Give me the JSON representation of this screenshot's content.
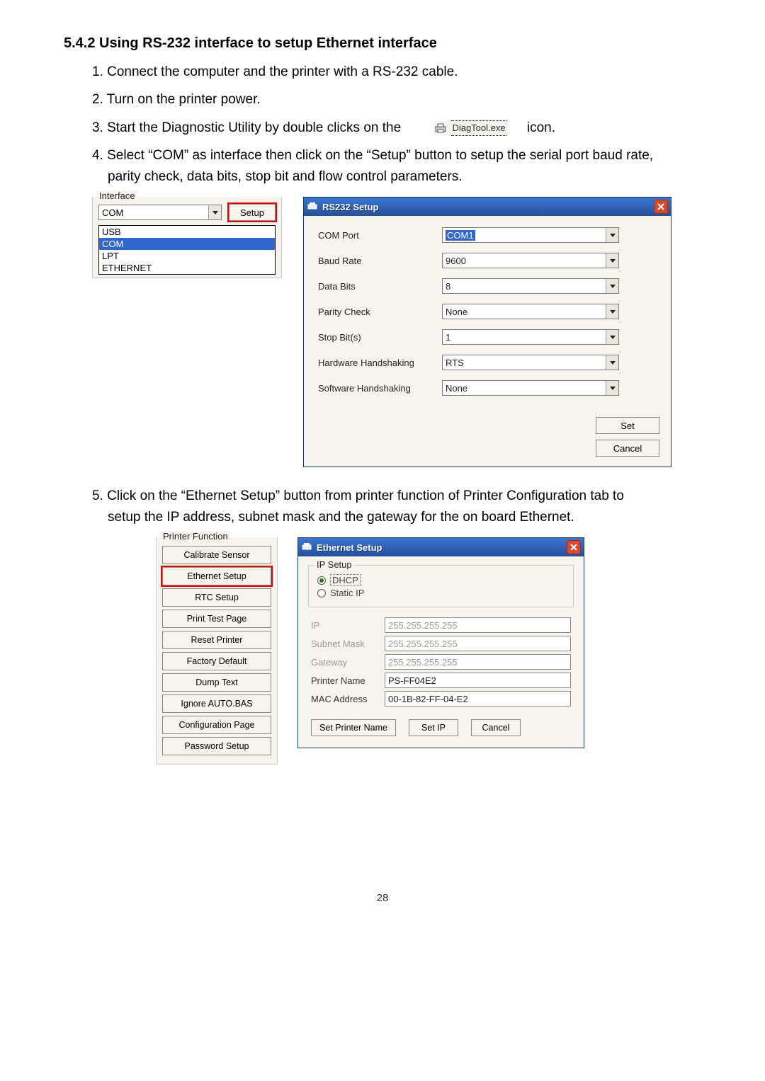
{
  "section": {
    "title": "5.4.2 Using RS-232 interface to setup Ethernet interface",
    "steps": {
      "s1": "1. Connect the computer and the printer with a RS-232 cable.",
      "s2": "2. Turn on the printer power.",
      "s3_a": "3. Start the Diagnostic Utility by double clicks on the",
      "s3_b": "icon.",
      "s4_a": "4. Select “COM” as interface then click on the “Setup” button to setup the serial port baud rate,",
      "s4_b": "parity check, data bits, stop bit and flow control parameters.",
      "s5_a": "5. Click on the “Ethernet Setup” button from printer function of Printer Configuration tab to",
      "s5_b": "setup the IP address, subnet mask and the gateway for the on board Ethernet."
    },
    "diagtool_label": "DiagTool.exe"
  },
  "interface_panel": {
    "group_label": "Interface",
    "selected": "COM",
    "setup_btn": "Setup",
    "options": {
      "o1": "USB",
      "o2": "COM",
      "o3": "LPT",
      "o4": "ETHERNET"
    }
  },
  "rs232": {
    "title": "RS232 Setup",
    "rows": {
      "r1": {
        "label": "COM Port",
        "value": "COM1"
      },
      "r2": {
        "label": "Baud Rate",
        "value": "9600"
      },
      "r3": {
        "label": "Data Bits",
        "value": "8"
      },
      "r4": {
        "label": "Parity Check",
        "value": "None"
      },
      "r5": {
        "label": "Stop Bit(s)",
        "value": "1"
      },
      "r6": {
        "label": "Hardware Handshaking",
        "value": "RTS"
      },
      "r7": {
        "label": "Software Handshaking",
        "value": "None"
      }
    },
    "set_btn": "Set",
    "cancel_btn": "Cancel"
  },
  "printer_function": {
    "group_label": "Printer Function",
    "buttons": {
      "b1": "Calibrate Sensor",
      "b2": "Ethernet Setup",
      "b3": "RTC Setup",
      "b4": "Print Test Page",
      "b5": "Reset Printer",
      "b6": "Factory Default",
      "b7": "Dump Text",
      "b8": "Ignore AUTO.BAS",
      "b9": "Configuration Page",
      "b10": "Password Setup"
    }
  },
  "ethernet": {
    "title": "Ethernet Setup",
    "ip_setup_label": "IP Setup",
    "dhcp": "DHCP",
    "static": "Static IP",
    "fields": {
      "ip": {
        "label": "IP",
        "value": "255.255.255.255"
      },
      "subnet": {
        "label": "Subnet Mask",
        "value": "255.255.255.255"
      },
      "gateway": {
        "label": "Gateway",
        "value": "255.255.255.255"
      },
      "pname": {
        "label": "Printer Name",
        "value": "PS-FF04E2"
      },
      "mac": {
        "label": "MAC Address",
        "value": "00-1B-82-FF-04-E2"
      }
    },
    "set_printer_name": "Set Printer Name",
    "set_ip": "Set IP",
    "cancel": "Cancel"
  },
  "page_number": "28"
}
